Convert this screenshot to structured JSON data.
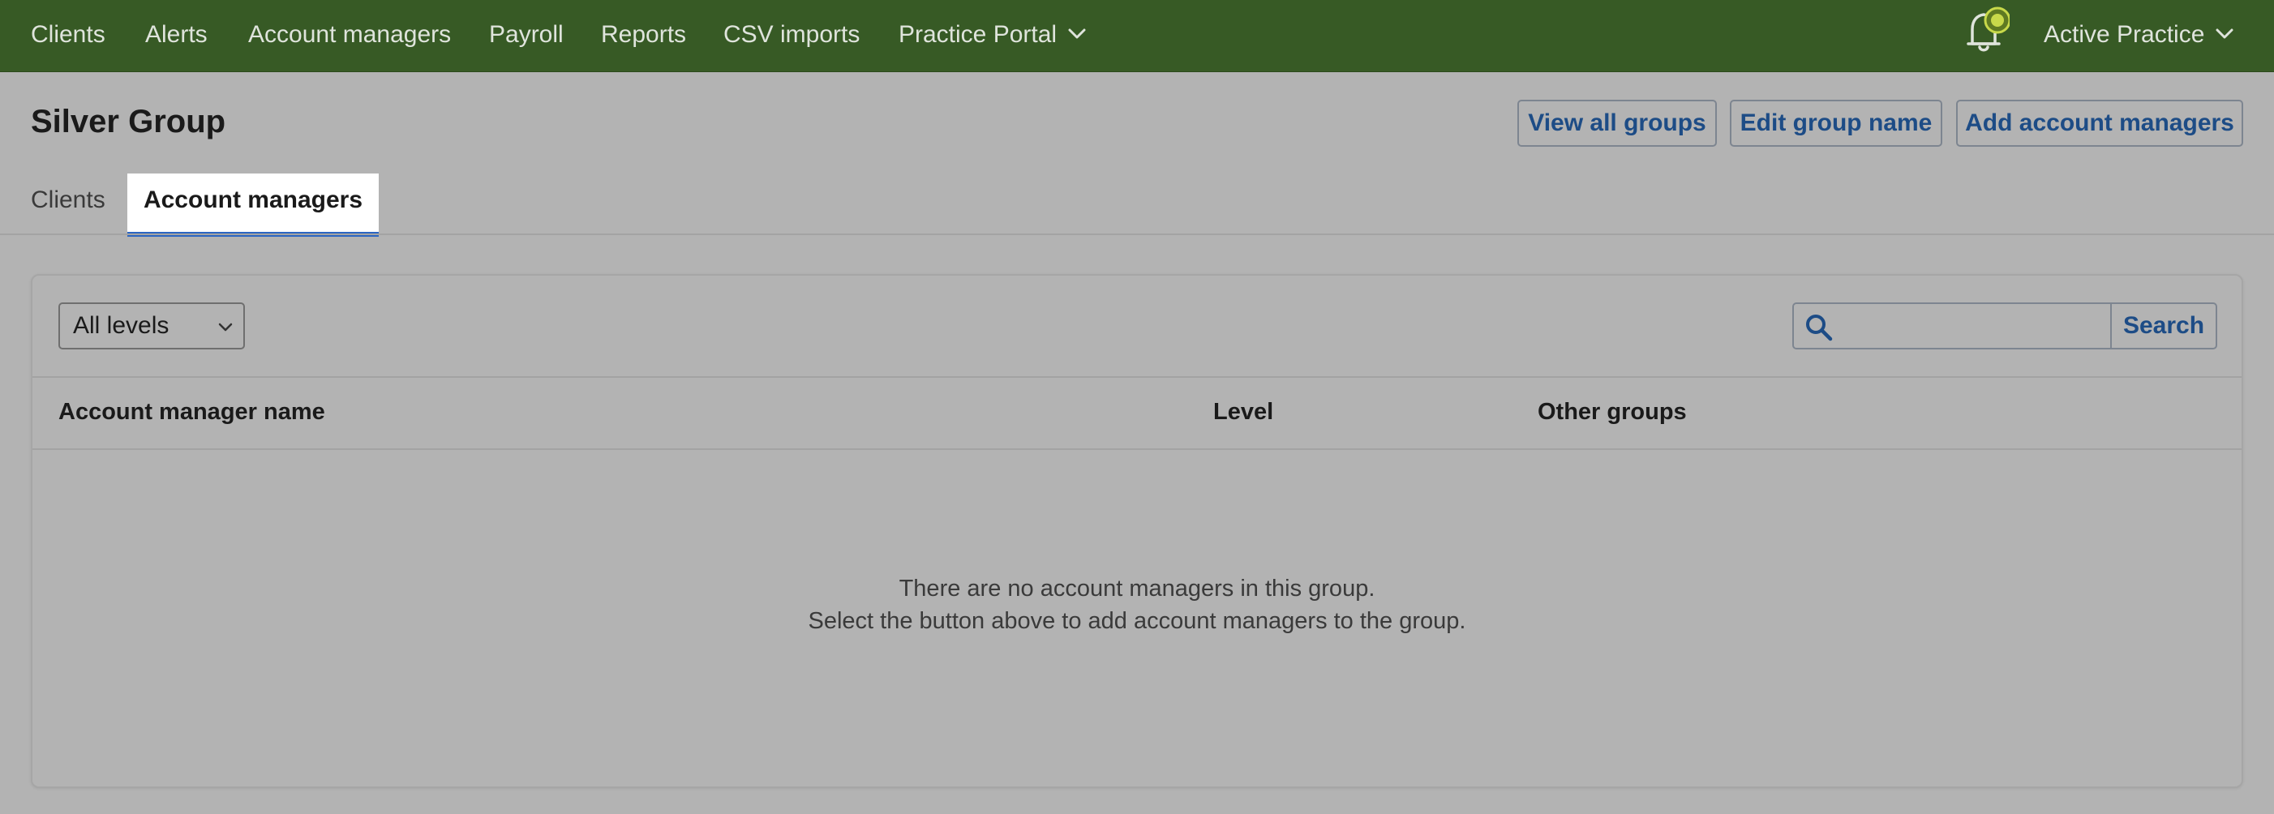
{
  "nav": {
    "items": [
      {
        "label": "Clients"
      },
      {
        "label": "Alerts"
      },
      {
        "label": "Account managers"
      },
      {
        "label": "Payroll"
      },
      {
        "label": "Reports"
      },
      {
        "label": "CSV imports"
      },
      {
        "label": "Practice Portal"
      }
    ],
    "account_label": "Active Practice",
    "bar_color": "#375a25"
  },
  "header": {
    "title": "Silver Group",
    "buttons": {
      "view_all": "View all groups",
      "edit_name": "Edit group name",
      "add_managers": "Add account managers"
    }
  },
  "tabs": [
    {
      "label": "Clients",
      "active": false
    },
    {
      "label": "Account managers",
      "active": true
    }
  ],
  "filters": {
    "level_select": "All levels",
    "search_placeholder": "",
    "search_button": "Search"
  },
  "table": {
    "columns": [
      "Account manager name",
      "Level",
      "Other groups"
    ],
    "rows": [],
    "empty_line1": "There are no account managers in this group.",
    "empty_line2": "Select the button above to add account managers to the group."
  },
  "colors": {
    "accent_tab_underline": "#2c66c2",
    "link_blue": "#1d4c86",
    "notification_dot": "#c8d94a"
  }
}
